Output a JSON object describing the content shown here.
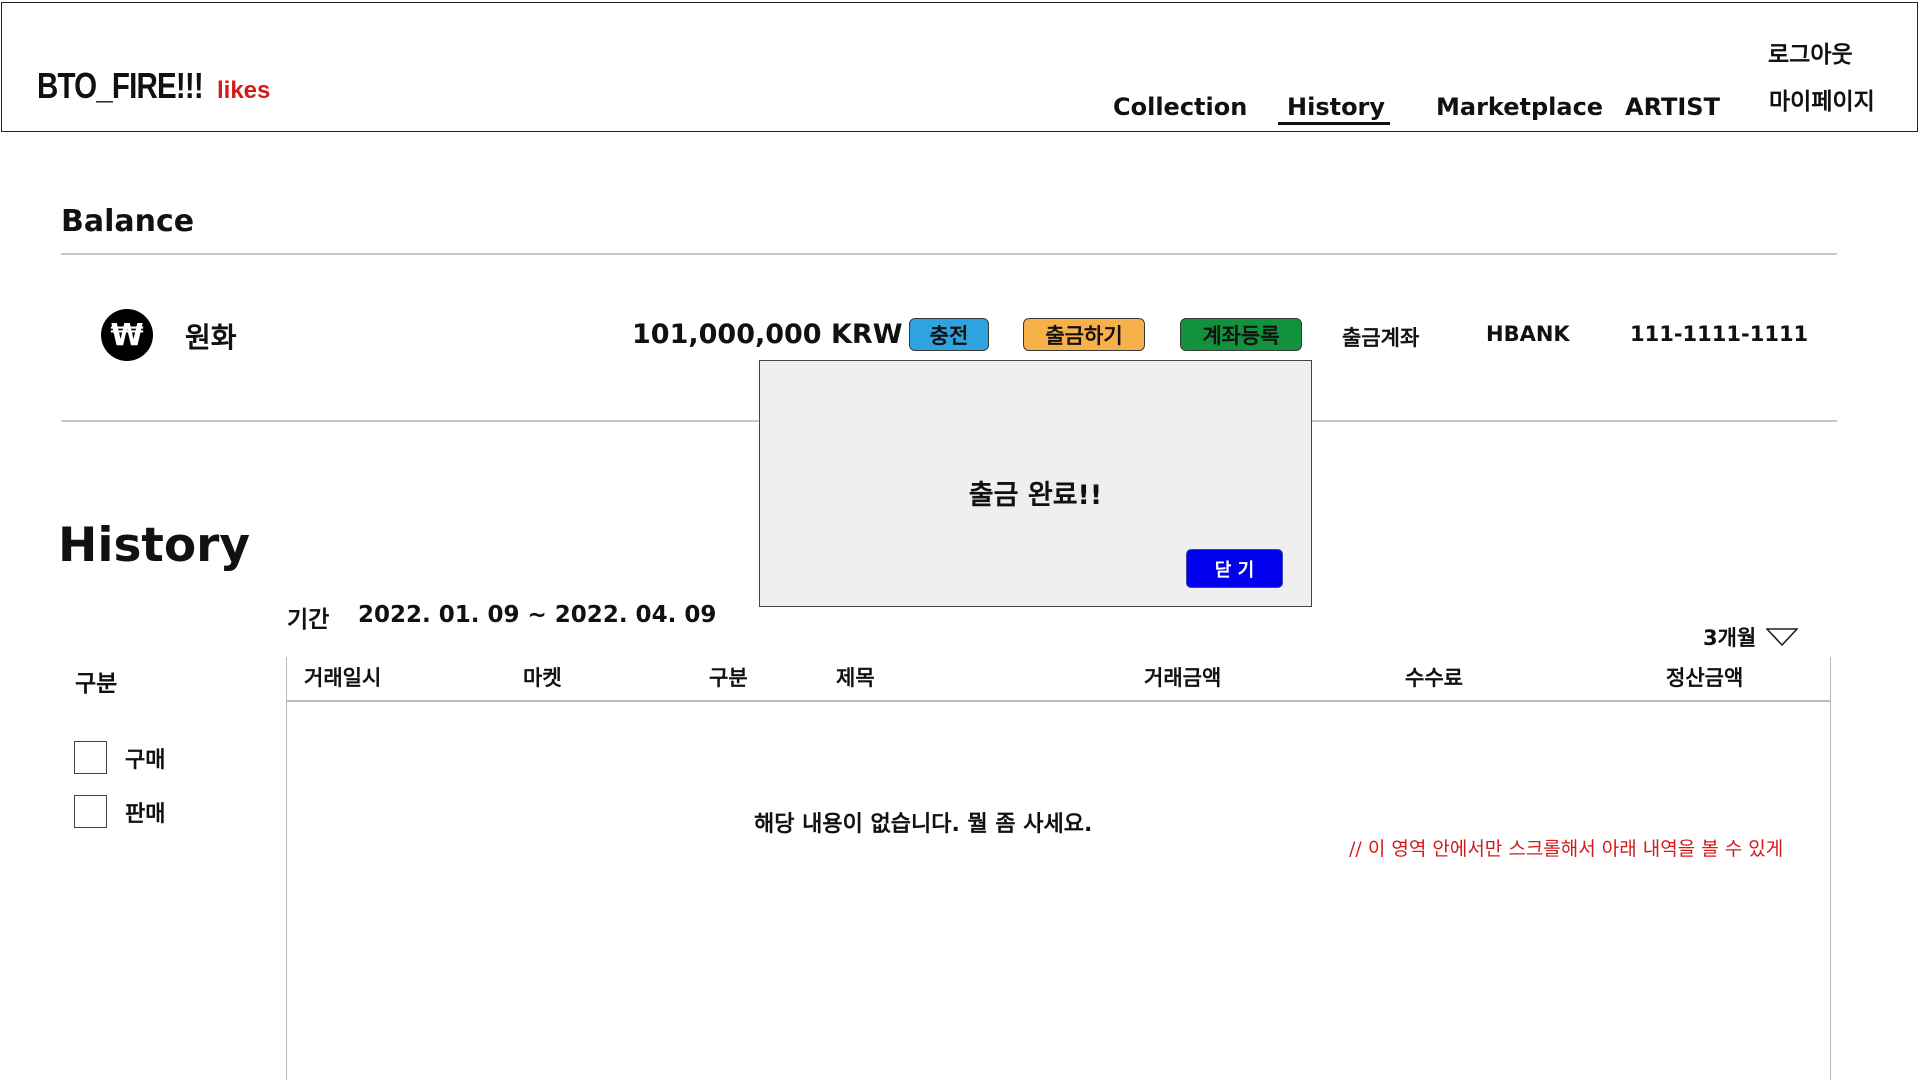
{
  "header": {
    "logo": "BTO_FIRE!!!",
    "logo_suffix": "likes",
    "nav": [
      "Collection",
      "History",
      "Marketplace",
      "ARTIST"
    ],
    "active_nav": "History",
    "logout": "로그아웃",
    "mypage": "마이페이지"
  },
  "balance": {
    "title": "Balance",
    "currency_symbol": "₩",
    "currency_name": "원화",
    "amount": "101,000,000 KRW",
    "buttons": {
      "charge": "충전",
      "withdraw": "출금하기",
      "register_account": "계좌등록"
    },
    "button_colors": {
      "charge": "#2fa3e0",
      "withdraw": "#f7b04a",
      "register_account": "#12923c"
    },
    "account_label": "출금계좌",
    "bank": "HBANK",
    "account_number": "111-1111-1111"
  },
  "modal": {
    "message": "출금 완료!!",
    "close_label": "닫 기"
  },
  "history": {
    "title": "History",
    "period_label": "기간",
    "period_value": "2022. 01. 09 ~ 2022. 04. 09",
    "range_option": "3개월",
    "filter": {
      "title": "구분",
      "options": [
        "구매",
        "판매"
      ]
    },
    "columns": [
      "거래일시",
      "마켓",
      "구분",
      "제목",
      "거래금액",
      "수수료",
      "정산금액"
    ],
    "empty_message": "해당 내용이 없습니다. 뭘 좀 사세요.",
    "note": "// 이 영역 안에서만 스크롤해서 아래 내역을 볼 수 있게"
  }
}
